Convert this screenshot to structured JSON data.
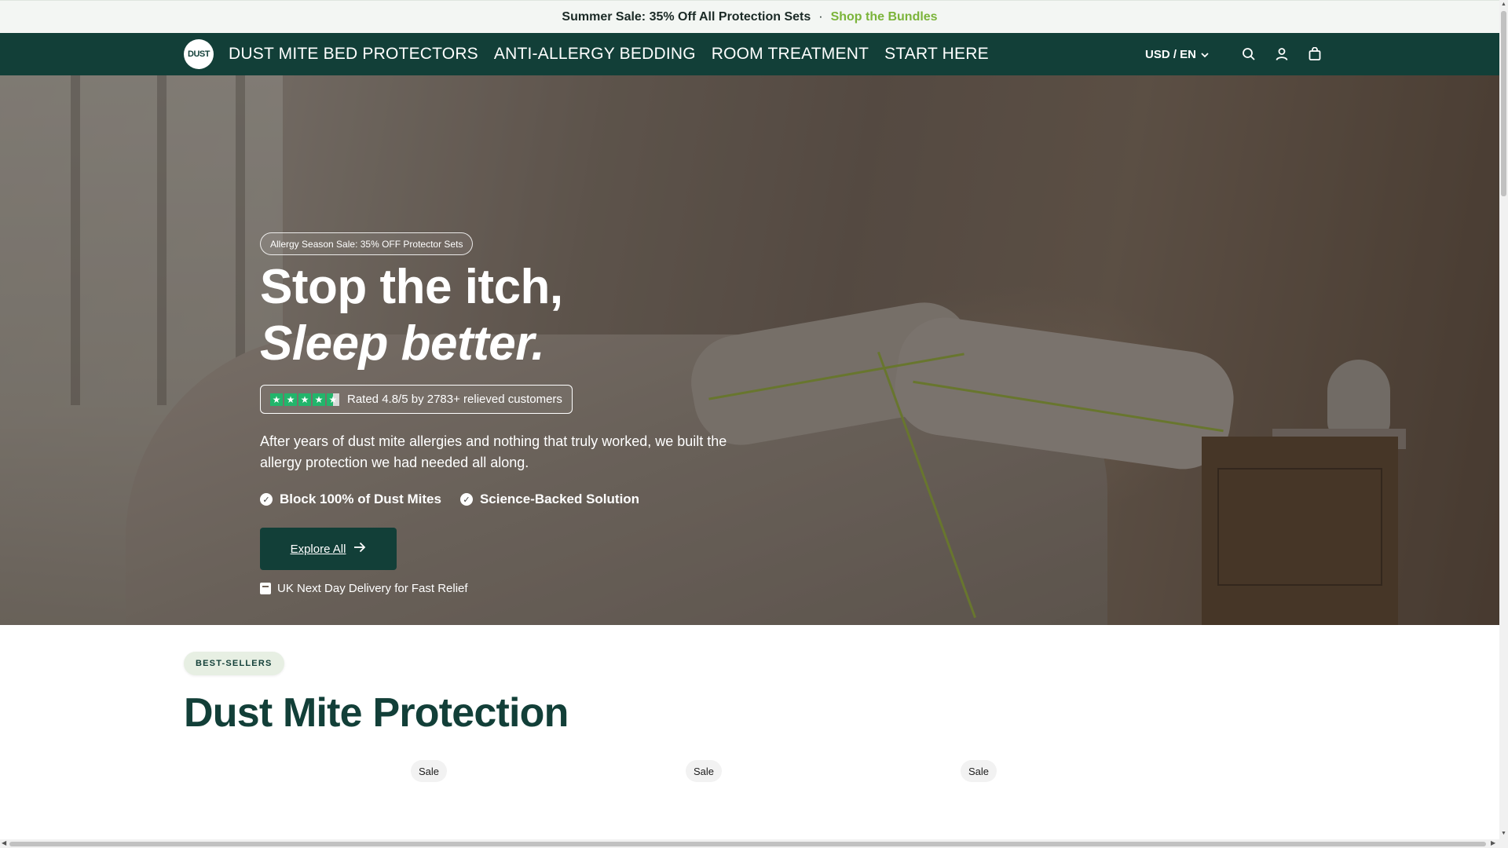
{
  "announcement": {
    "text": "Summer Sale: 35% Off All Protection Sets",
    "separator": "·",
    "link_label": "Shop the Bundles"
  },
  "header": {
    "logo_text": "DUST",
    "nav": [
      {
        "label": "DUST MITE BED PROTECTORS"
      },
      {
        "label": "ANTI-ALLERGY BEDDING"
      },
      {
        "label": "ROOM TREATMENT"
      },
      {
        "label": "START HERE"
      }
    ],
    "currency_label": "USD / EN",
    "icons": [
      "search-icon",
      "account-icon",
      "cart-icon"
    ]
  },
  "hero": {
    "promo_pill": "Allergy Season Sale: 35% OFF Protector Sets",
    "headline_line1": "Stop the itch,",
    "headline_line2": "Sleep better.",
    "rating_text": "Rated 4.8/5 by 2783+ relieved customers",
    "rating_value": 4.5,
    "rating_max": 5,
    "description": "After years of dust mite allergies and nothing that truly worked, we built the allergy protection we had needed all along.",
    "features": [
      {
        "label": "Block 100% of Dust Mites"
      },
      {
        "label": "Science-Backed Solution"
      }
    ],
    "cta_label": "Explore All",
    "delivery_text": "UK Next Day Delivery for Fast Relief"
  },
  "bestsellers": {
    "badge": "BEST-SELLERS",
    "title": "Dust Mite Protection",
    "sale_tags": [
      "Sale",
      "Sale",
      "Sale"
    ]
  },
  "colors": {
    "brand_dark_green": "#123f38",
    "accent_green": "#7bb43a",
    "trustpilot_green": "#22b56b"
  }
}
